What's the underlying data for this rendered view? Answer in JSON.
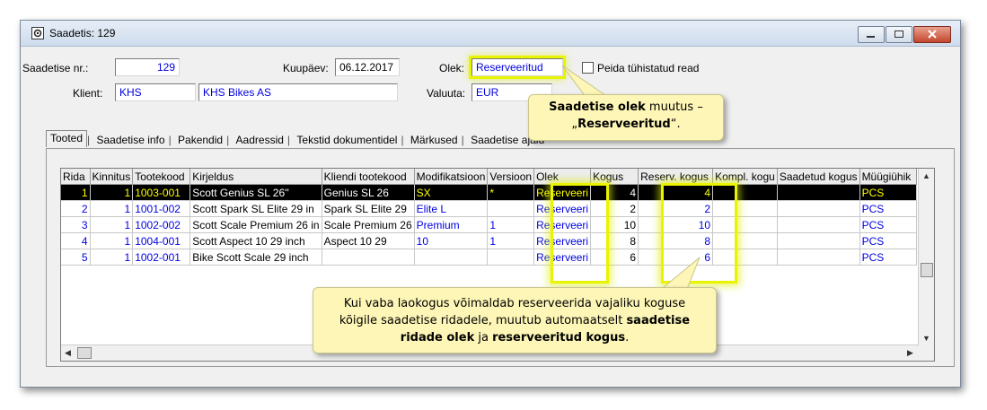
{
  "window": {
    "title": "Saadetis: 129"
  },
  "header": {
    "saadetis_nr_label": "Saadetise nr.:",
    "saadetis_nr_value": "129",
    "kuupaev_label": "Kuupäev:",
    "kuupaev_value": "06.12.2017",
    "olek_label": "Olek:",
    "olek_value": "Reserveeritud",
    "peida_label": "Peida tühistatud read",
    "klient_label": "Klient:",
    "klient_code": "KHS",
    "klient_name": "KHS Bikes AS",
    "valuuta_label": "Valuuta:",
    "valuuta_value": "EUR"
  },
  "tabs": [
    "Tooted",
    "Saadetise info",
    "Pakendid",
    "Aadressid",
    "Tekstid dokumentidel",
    "Märkused",
    "Saadetise ajalu"
  ],
  "table": {
    "columns": [
      "Rida",
      "Kinnitus",
      "Tootekood",
      "Kirjeldus",
      "Kliendi tootekood",
      "Modifikatsioon",
      "Versioon",
      "Olek",
      "Kogus",
      "Reserv. kogus",
      "Kompl. kogu",
      "Saadetud kogus",
      "Müügiühik"
    ],
    "rows": [
      [
        "1",
        "1",
        "1003-001",
        "Scott Genius SL 26''",
        "Genius SL 26",
        "SX",
        "*",
        "Reserveeri",
        "4",
        "4",
        "",
        "",
        "PCS"
      ],
      [
        "2",
        "1",
        "1001-002",
        "Scott Spark SL Elite 29 in",
        "Spark SL Elite 29",
        "Elite L",
        "",
        "Reserveeri",
        "2",
        "2",
        "",
        "",
        "PCS"
      ],
      [
        "3",
        "1",
        "1002-002",
        "Scott Scale Premium 26 in",
        "Scale Premium 26",
        "Premium",
        "1",
        "Reserveeri",
        "10",
        "10",
        "",
        "",
        "PCS"
      ],
      [
        "4",
        "1",
        "1004-001",
        "Scott Aspect 10 29 inch",
        "Aspect 10 29",
        "10",
        "1",
        "Reserveeri",
        "8",
        "8",
        "",
        "",
        "PCS"
      ],
      [
        "5",
        "1",
        "1002-001",
        "Bike Scott Scale 29 inch",
        "",
        "",
        "",
        "Reserveeri",
        "6",
        "6",
        "",
        "",
        "PCS"
      ]
    ]
  },
  "callouts": {
    "top_bold": "Saadetise olek",
    "top_text1": " muutus –",
    "top_text2": "„",
    "top_bold2": "Reserveeritud",
    "top_text3": "“.",
    "bottom_line1": "Kui vaba laokogus võimaldab reserveerida vajaliku koguse",
    "bottom_line2a": "kõigile saadetise ridadele, muutub automaatselt ",
    "bottom_line2b": "saadetise",
    "bottom_line3a": "ridade olek",
    "bottom_line3b": " ja ",
    "bottom_line3c": "reserveeritud kogus",
    "bottom_line3d": "."
  },
  "colors": {
    "highlight": "#e9f400",
    "callout_bg": "#fdf6b6",
    "value_blue": "#0000e0"
  }
}
